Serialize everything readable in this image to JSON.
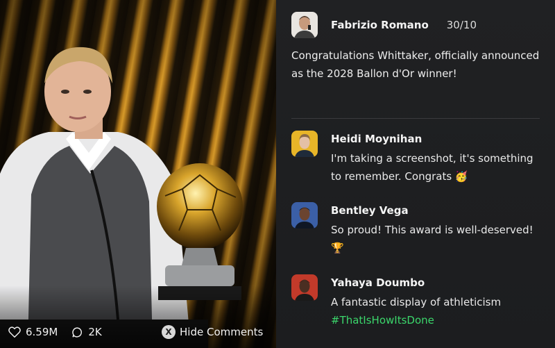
{
  "post": {
    "author": "Fabrizio Romano",
    "date": "30/10",
    "text": "Congratulations Whittaker, officially announced as the 2028 Ballon d'Or winner!",
    "avatar_icon": "man-portrait-avatar"
  },
  "comments": [
    {
      "author": "Heidi Moynihan",
      "text": "I'm taking a screenshot, it's something to remember. Congrats 🥳",
      "avatar_color": "#e8b528",
      "avatar_icon": "woman-portrait-avatar"
    },
    {
      "author": "Bentley Vega",
      "text": "So proud! This award is well-deserved! 🏆",
      "avatar_color": "#3b5fa6",
      "avatar_icon": "man-portrait-avatar"
    },
    {
      "author": "Yahaya Doumbo",
      "text": "A fantastic display of athleticism",
      "hashtag": "#ThatIsHowItsDone",
      "avatar_color": "#c23a2a",
      "avatar_icon": "man-portrait-avatar"
    }
  ],
  "stats": {
    "likes": "6.59M",
    "comments": "2K",
    "like_icon": "heart-icon",
    "comment_icon": "chat-bubble-icon"
  },
  "controls": {
    "hide_button_glyph": "X",
    "hide_label": "Hide Comments"
  },
  "colors": {
    "hashtag": "#3bd66b",
    "panel_bg": "#1f2022",
    "accent_gold": "#d79a2a"
  }
}
